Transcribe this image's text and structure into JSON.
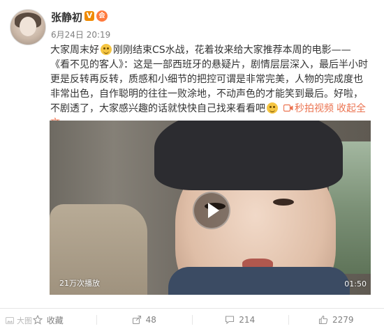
{
  "post": {
    "username": "张静初",
    "verified_badge": "V",
    "member_badge": "会",
    "date": "6月24日 20:19",
    "text_1": "大家周末好",
    "text_2": "刚刚结束CS水战，花着妆来给大家推荐本周的电影——《看不见的客人》：这是一部西班牙的悬疑片，剧情层层深入，最后半小时更是反转再反转，质感和小细节的把控可谓是非常完美，人物的完成度也非常出色，自作聪明的往往一败涂地，不动声色的才能笑到最后。好啦，不剧透了，大家感兴趣的话就快快自己找来看看吧",
    "video_link": "秒拍视频",
    "collapse": "收起全文"
  },
  "video": {
    "view_count": "21万次播放",
    "duration": "01:50"
  },
  "actions": {
    "favorite_label": "收藏",
    "share_count": "48",
    "comment_count": "214",
    "like_count": "2279"
  },
  "watermark": "大图"
}
